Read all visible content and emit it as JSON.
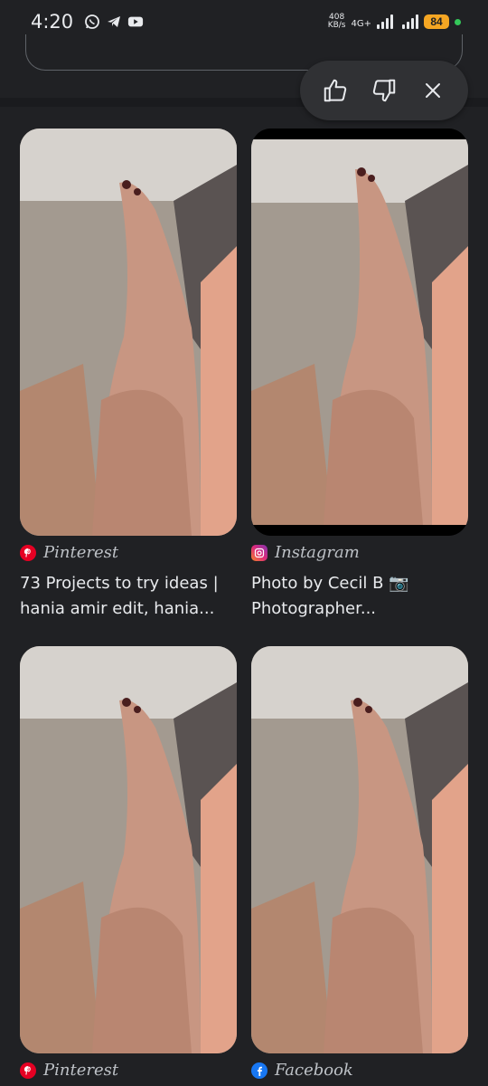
{
  "status": {
    "time": "4:20",
    "net_speed_value": "408",
    "net_speed_unit": "KB/s",
    "net_type": "4G+",
    "battery": "84"
  },
  "feedback": {
    "like_icon": "thumbs-up-icon",
    "dislike_icon": "thumbs-down-icon",
    "close_icon": "close-icon"
  },
  "results": [
    {
      "source": "Pinterest",
      "title_line1": "73 Projects to try ideas |",
      "title_line2": "hania amir edit, hania..."
    },
    {
      "source": "Instagram",
      "title_line1": "Photo by Cecil B 📷",
      "title_line2": "Photographer..."
    },
    {
      "source": "Pinterest",
      "title_line1": "",
      "title_line2": ""
    },
    {
      "source": "Facebook",
      "title_line1": "",
      "title_line2": ""
    }
  ],
  "colors": {
    "background": "#202124",
    "pinterest": "#e60023",
    "facebook": "#1877f2",
    "instagram": "#dd2a7b",
    "battery": "#f5a623"
  }
}
